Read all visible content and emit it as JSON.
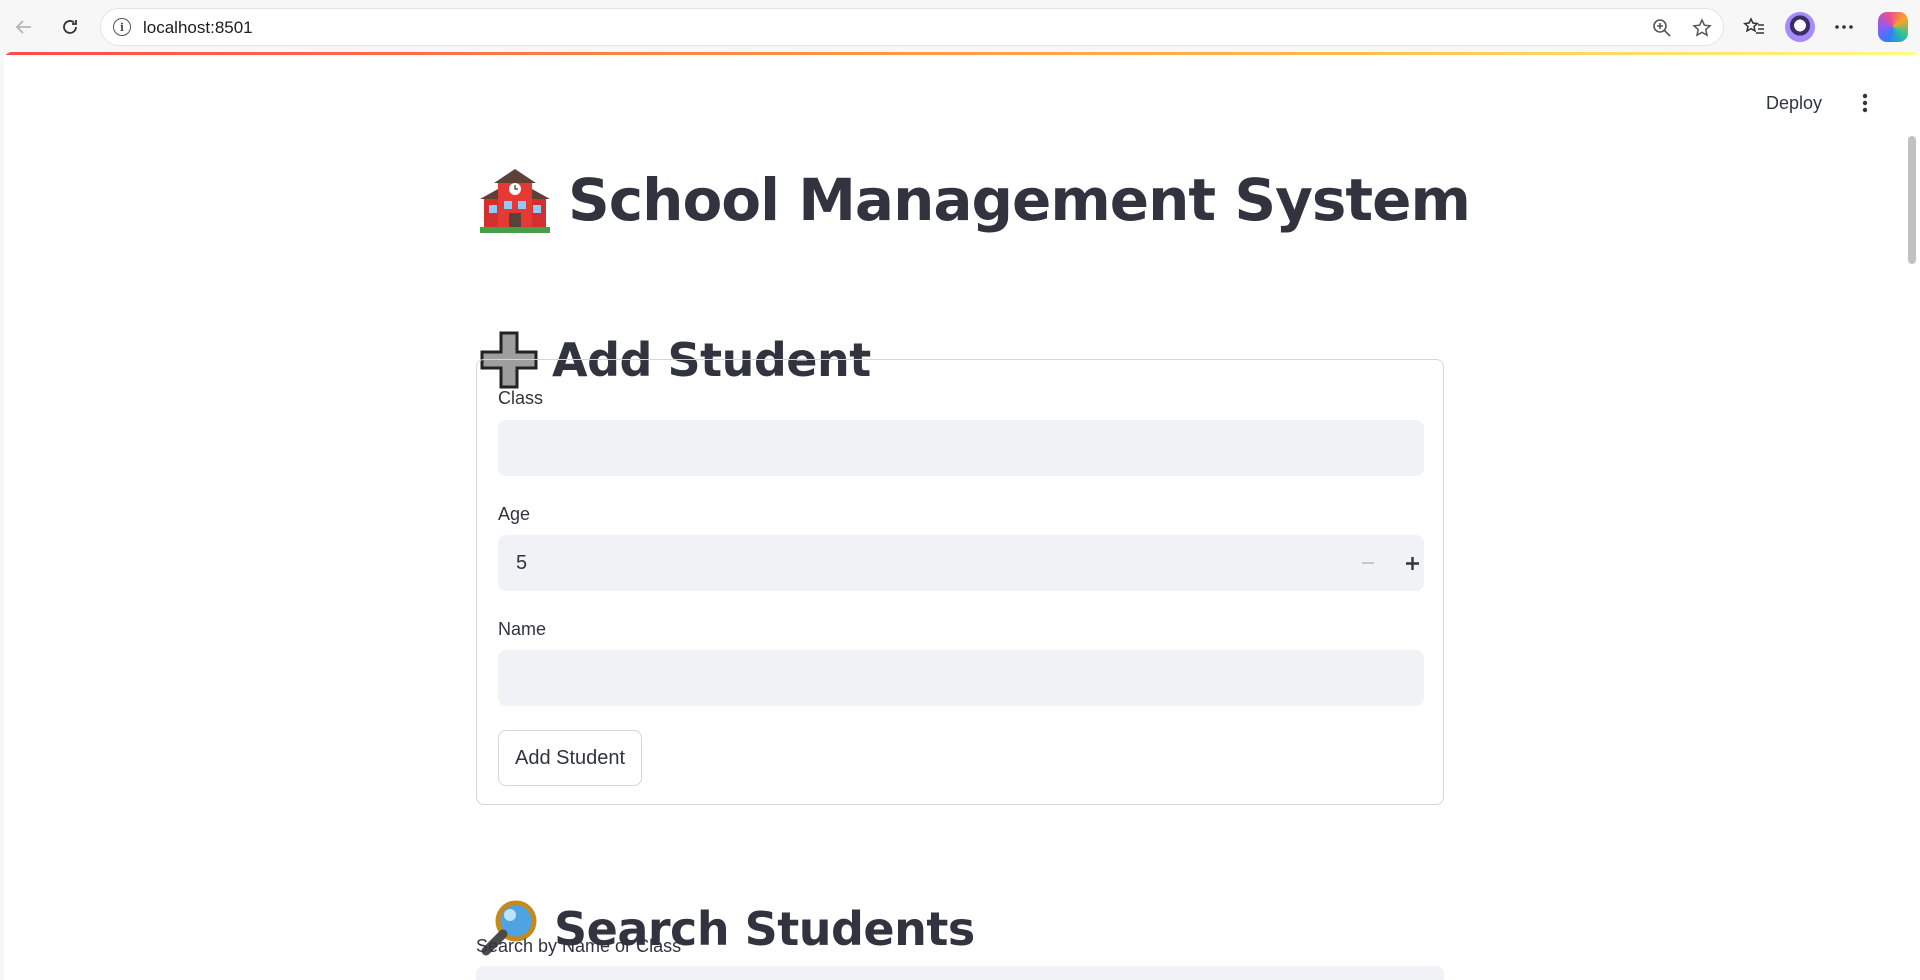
{
  "browser": {
    "url": "localhost:8501",
    "icons": [
      "back-arrow-icon",
      "refresh-icon",
      "info-icon",
      "zoom-icon",
      "favorite-star-icon",
      "favorites-icon",
      "profile-avatar",
      "more-icon",
      "copilot-icon"
    ]
  },
  "app": {
    "deploy_label": "Deploy",
    "title": "School Management System",
    "title_emoji": "school",
    "add_section": {
      "heading": "Add Student",
      "heading_emoji": "heavy-plus-sign",
      "class_label": "Class",
      "class_value": "",
      "age_label": "Age",
      "age_value": "5",
      "name_label": "Name",
      "name_value": "",
      "submit_label": "Add Student"
    },
    "search_section": {
      "heading": "Search Students",
      "heading_emoji": "magnifying-glass",
      "search_label": "Search by Name or Class",
      "search_value": ""
    }
  },
  "colors": {
    "text": "#31333f",
    "input_bg": "#f0f2f6",
    "border": "#d6d6d9",
    "accent_start": "#ff4b4b",
    "accent_end": "#fffd80"
  }
}
